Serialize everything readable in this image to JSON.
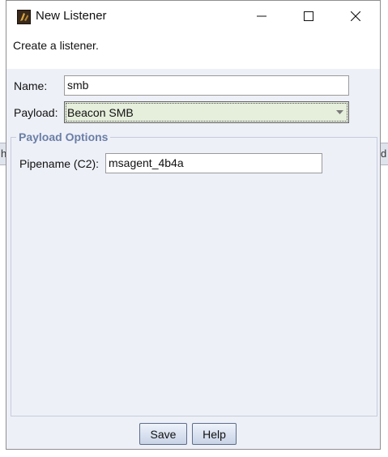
{
  "window": {
    "title": "New Listener",
    "icon": "app-icon",
    "controls": {
      "minimize_icon": "minimize-icon",
      "maximize_icon": "maximize-icon",
      "close_icon": "close-icon"
    }
  },
  "description": "Create a listener.",
  "form": {
    "name_label": "Name:",
    "name_value": "smb",
    "payload_label": "Payload:",
    "payload_value": "Beacon SMB"
  },
  "payload_options": {
    "title": "Payload Options",
    "pipename_label": "Pipename (C2):",
    "pipename_value": "msagent_4b4a"
  },
  "buttons": {
    "save": "Save",
    "help": "Help"
  },
  "background": {
    "left_glimpse": "h",
    "right_glimpse": "d"
  },
  "colors": {
    "panel_background": "#eef0f8",
    "combo_background": "#e6eedc",
    "section_title": "#6a7fa6",
    "button_border": "#5d6d8a"
  }
}
